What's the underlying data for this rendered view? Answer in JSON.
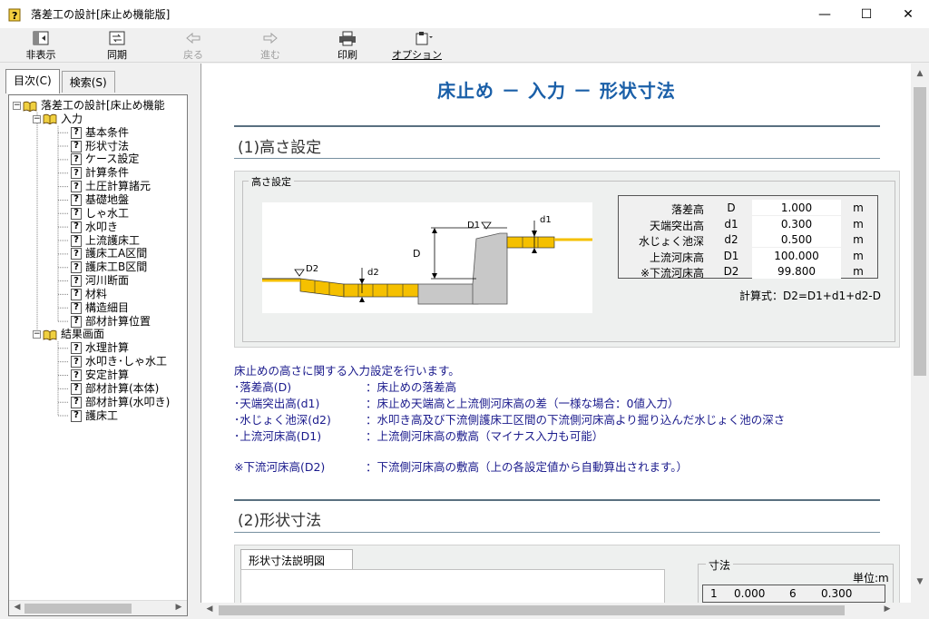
{
  "window": {
    "title": "落差工の設計[床止め機能版]",
    "minimize": "—",
    "maximize": "☐",
    "close": "✕"
  },
  "toolbar": {
    "hide": "非表示",
    "sync": "同期",
    "back": "戻る",
    "forward": "進む",
    "print": "印刷",
    "options": "オプション(O)"
  },
  "tabs": {
    "contents": "目次(C)",
    "search": "検索(S)"
  },
  "tree": {
    "root": "落差工の設計[床止め機能",
    "input_folder": "入力",
    "input_items": [
      "基本条件",
      "形状寸法",
      "ケース設定",
      "計算条件",
      "土圧計算諸元",
      "基礎地盤",
      "しゃ水工",
      "水叩き",
      "上流護床工",
      "護床工A区間",
      "護床工B区間",
      "河川断面",
      "材料",
      "構造細目",
      "部材計算位置"
    ],
    "result_folder": "結果画面",
    "result_items": [
      "水理計算",
      "水叩き･しゃ水工",
      "安定計算",
      "部材計算(本体)",
      "部材計算(水叩き)",
      "護床工"
    ]
  },
  "content": {
    "page_title": "床止め － 入力 － 形状寸法",
    "section1": "(1)高さ設定",
    "group_label": "高さ設定",
    "diagram_labels": {
      "D": "D",
      "d1": "d1",
      "d2": "d2",
      "D1": "D1",
      "D2": "D2"
    },
    "params": [
      {
        "name": "落差高",
        "sym": "D",
        "value": "1.000",
        "unit": "m"
      },
      {
        "name": "天端突出高",
        "sym": "d1",
        "value": "0.300",
        "unit": "m"
      },
      {
        "name": "水じょく池深",
        "sym": "d2",
        "value": "0.500",
        "unit": "m"
      },
      {
        "name": "上流河床高",
        "sym": "D1",
        "value": "100.000",
        "unit": "m"
      },
      {
        "name": "※下流河床高",
        "sym": "D2",
        "value": "99.800",
        "unit": "m"
      }
    ],
    "formula": "計算式：D2=D1+d1+d2-D",
    "intro": "床止めの高さに関する入力設定を行います。",
    "descs": [
      {
        "k": "･落差高(D)",
        "v": "：床止めの落差高"
      },
      {
        "k": "･天端突出高(d1)",
        "v": "：床止め天端高と上流側河床高の差（一様な場合：0値入力）"
      },
      {
        "k": "･水じょく池深(d2)",
        "v": "：水叩き高及び下流側護床工区間の下流側河床高より掘り込んだ水じょく池の深さ"
      },
      {
        "k": "･上流河床高(D1)",
        "v": "：上流側河床高の敷高（マイナス入力も可能）"
      }
    ],
    "note": {
      "k": "※下流河床高(D2)",
      "v": "：下流側河床高の敷高（上の各設定値から自動算出されます。）"
    },
    "section2": "(2)形状寸法",
    "subtab": "形状寸法説明図",
    "dim_label": "寸法",
    "unit_label": "単位:m",
    "dim_row": {
      "no": "1",
      "v1": "0.000",
      "n2": "6",
      "v2": "0.300"
    }
  },
  "colors": {
    "title_blue": "#1a5fa8",
    "desc_navy": "#1a1a8c",
    "block_yellow": "#f5c000",
    "concrete_gray": "#c8c8c8"
  }
}
